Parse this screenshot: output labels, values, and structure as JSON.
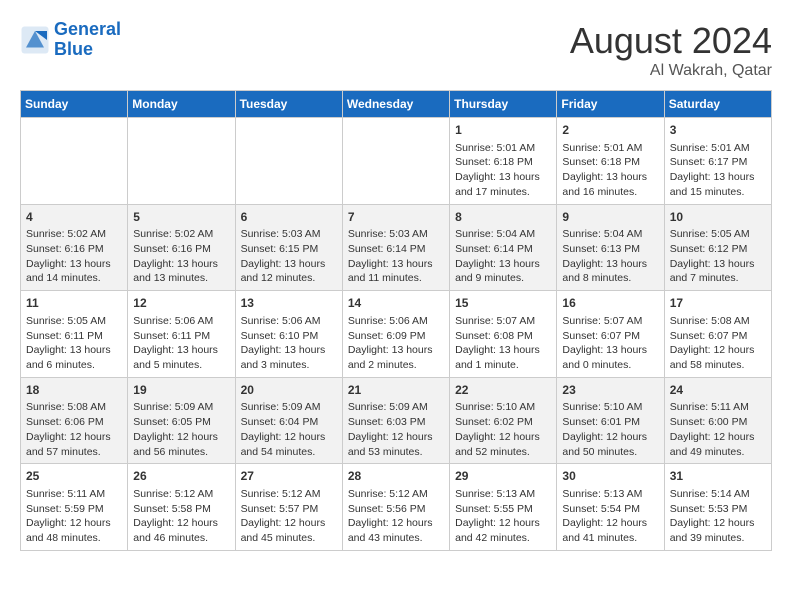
{
  "header": {
    "logo_line1": "General",
    "logo_line2": "Blue",
    "month_year": "August 2024",
    "location": "Al Wakrah, Qatar"
  },
  "weekdays": [
    "Sunday",
    "Monday",
    "Tuesday",
    "Wednesday",
    "Thursday",
    "Friday",
    "Saturday"
  ],
  "weeks": [
    [
      {
        "day": "",
        "content": ""
      },
      {
        "day": "",
        "content": ""
      },
      {
        "day": "",
        "content": ""
      },
      {
        "day": "",
        "content": ""
      },
      {
        "day": "1",
        "content": "Sunrise: 5:01 AM\nSunset: 6:18 PM\nDaylight: 13 hours\nand 17 minutes."
      },
      {
        "day": "2",
        "content": "Sunrise: 5:01 AM\nSunset: 6:18 PM\nDaylight: 13 hours\nand 16 minutes."
      },
      {
        "day": "3",
        "content": "Sunrise: 5:01 AM\nSunset: 6:17 PM\nDaylight: 13 hours\nand 15 minutes."
      }
    ],
    [
      {
        "day": "4",
        "content": "Sunrise: 5:02 AM\nSunset: 6:16 PM\nDaylight: 13 hours\nand 14 minutes."
      },
      {
        "day": "5",
        "content": "Sunrise: 5:02 AM\nSunset: 6:16 PM\nDaylight: 13 hours\nand 13 minutes."
      },
      {
        "day": "6",
        "content": "Sunrise: 5:03 AM\nSunset: 6:15 PM\nDaylight: 13 hours\nand 12 minutes."
      },
      {
        "day": "7",
        "content": "Sunrise: 5:03 AM\nSunset: 6:14 PM\nDaylight: 13 hours\nand 11 minutes."
      },
      {
        "day": "8",
        "content": "Sunrise: 5:04 AM\nSunset: 6:14 PM\nDaylight: 13 hours\nand 9 minutes."
      },
      {
        "day": "9",
        "content": "Sunrise: 5:04 AM\nSunset: 6:13 PM\nDaylight: 13 hours\nand 8 minutes."
      },
      {
        "day": "10",
        "content": "Sunrise: 5:05 AM\nSunset: 6:12 PM\nDaylight: 13 hours\nand 7 minutes."
      }
    ],
    [
      {
        "day": "11",
        "content": "Sunrise: 5:05 AM\nSunset: 6:11 PM\nDaylight: 13 hours\nand 6 minutes."
      },
      {
        "day": "12",
        "content": "Sunrise: 5:06 AM\nSunset: 6:11 PM\nDaylight: 13 hours\nand 5 minutes."
      },
      {
        "day": "13",
        "content": "Sunrise: 5:06 AM\nSunset: 6:10 PM\nDaylight: 13 hours\nand 3 minutes."
      },
      {
        "day": "14",
        "content": "Sunrise: 5:06 AM\nSunset: 6:09 PM\nDaylight: 13 hours\nand 2 minutes."
      },
      {
        "day": "15",
        "content": "Sunrise: 5:07 AM\nSunset: 6:08 PM\nDaylight: 13 hours\nand 1 minute."
      },
      {
        "day": "16",
        "content": "Sunrise: 5:07 AM\nSunset: 6:07 PM\nDaylight: 13 hours\nand 0 minutes."
      },
      {
        "day": "17",
        "content": "Sunrise: 5:08 AM\nSunset: 6:07 PM\nDaylight: 12 hours\nand 58 minutes."
      }
    ],
    [
      {
        "day": "18",
        "content": "Sunrise: 5:08 AM\nSunset: 6:06 PM\nDaylight: 12 hours\nand 57 minutes."
      },
      {
        "day": "19",
        "content": "Sunrise: 5:09 AM\nSunset: 6:05 PM\nDaylight: 12 hours\nand 56 minutes."
      },
      {
        "day": "20",
        "content": "Sunrise: 5:09 AM\nSunset: 6:04 PM\nDaylight: 12 hours\nand 54 minutes."
      },
      {
        "day": "21",
        "content": "Sunrise: 5:09 AM\nSunset: 6:03 PM\nDaylight: 12 hours\nand 53 minutes."
      },
      {
        "day": "22",
        "content": "Sunrise: 5:10 AM\nSunset: 6:02 PM\nDaylight: 12 hours\nand 52 minutes."
      },
      {
        "day": "23",
        "content": "Sunrise: 5:10 AM\nSunset: 6:01 PM\nDaylight: 12 hours\nand 50 minutes."
      },
      {
        "day": "24",
        "content": "Sunrise: 5:11 AM\nSunset: 6:00 PM\nDaylight: 12 hours\nand 49 minutes."
      }
    ],
    [
      {
        "day": "25",
        "content": "Sunrise: 5:11 AM\nSunset: 5:59 PM\nDaylight: 12 hours\nand 48 minutes."
      },
      {
        "day": "26",
        "content": "Sunrise: 5:12 AM\nSunset: 5:58 PM\nDaylight: 12 hours\nand 46 minutes."
      },
      {
        "day": "27",
        "content": "Sunrise: 5:12 AM\nSunset: 5:57 PM\nDaylight: 12 hours\nand 45 minutes."
      },
      {
        "day": "28",
        "content": "Sunrise: 5:12 AM\nSunset: 5:56 PM\nDaylight: 12 hours\nand 43 minutes."
      },
      {
        "day": "29",
        "content": "Sunrise: 5:13 AM\nSunset: 5:55 PM\nDaylight: 12 hours\nand 42 minutes."
      },
      {
        "day": "30",
        "content": "Sunrise: 5:13 AM\nSunset: 5:54 PM\nDaylight: 12 hours\nand 41 minutes."
      },
      {
        "day": "31",
        "content": "Sunrise: 5:14 AM\nSunset: 5:53 PM\nDaylight: 12 hours\nand 39 minutes."
      }
    ]
  ]
}
